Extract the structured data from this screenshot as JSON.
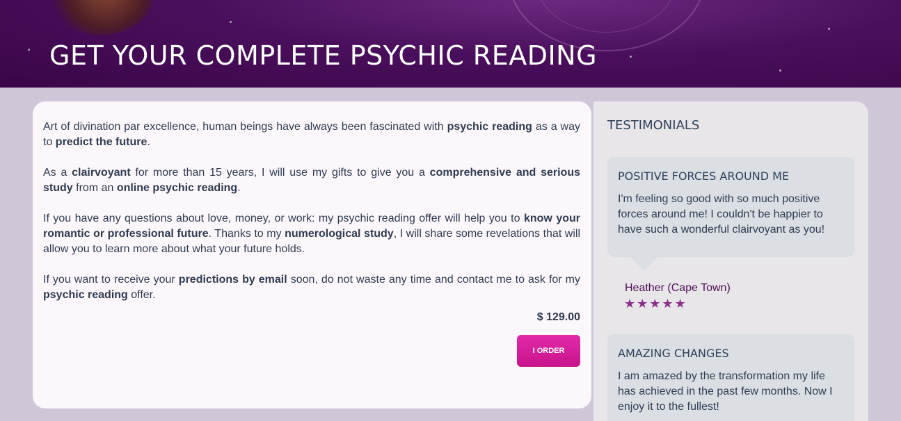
{
  "hero": {
    "title": "GET YOUR COMPLETE PSYCHIC READING"
  },
  "offer": {
    "paragraphs": [
      [
        {
          "t": "Art of divination par excellence, human beings have always been fascinated with ",
          "b": false
        },
        {
          "t": "psychic reading",
          "b": true
        },
        {
          "t": " as a way to ",
          "b": false
        },
        {
          "t": "predict the future",
          "b": true
        },
        {
          "t": ".",
          "b": false
        }
      ],
      [
        {
          "t": "As a ",
          "b": false
        },
        {
          "t": "clairvoyant",
          "b": true
        },
        {
          "t": " for more than 15 years, I will use my gifts to give you a ",
          "b": false
        },
        {
          "t": "comprehensive and serious study",
          "b": true
        },
        {
          "t": " from an ",
          "b": false
        },
        {
          "t": "online psychic reading",
          "b": true
        },
        {
          "t": ".",
          "b": false
        }
      ],
      [
        {
          "t": "If you have any questions about love, money, or work: my psychic reading offer will help you to ",
          "b": false
        },
        {
          "t": "know your romantic or professional future",
          "b": true
        },
        {
          "t": ". Thanks to my ",
          "b": false
        },
        {
          "t": "numerological study",
          "b": true
        },
        {
          "t": ", I will share some revelations that will allow you to learn more about what your future holds.",
          "b": false
        }
      ],
      [
        {
          "t": "If you want to receive your ",
          "b": false
        },
        {
          "t": "predictions by email",
          "b": true
        },
        {
          "t": " soon, do not waste any time and contact me to ask for my ",
          "b": false
        },
        {
          "t": "psychic reading",
          "b": true
        },
        {
          "t": " offer.",
          "b": false
        }
      ]
    ],
    "price": "$ 129.00",
    "order_label": "I ORDER"
  },
  "testimonials": {
    "heading": "TESTIMONIALS",
    "items": [
      {
        "title": "POSITIVE FORCES AROUND ME",
        "text": "I'm feeling so good with so much positive forces around me! I couldn't be happier to have such a wonderful clairvoyant as you!",
        "author": "Heather (Cape Town)",
        "rating": 5
      },
      {
        "title": "AMAZING CHANGES",
        "text": "I am amazed by the transformation my life has achieved in the past few months. Now I enjoy it to the fullest!"
      }
    ]
  },
  "colors": {
    "brand_purple": "#4a0f5c",
    "order_button": "#e22aa8",
    "star": "#8a2f88"
  }
}
